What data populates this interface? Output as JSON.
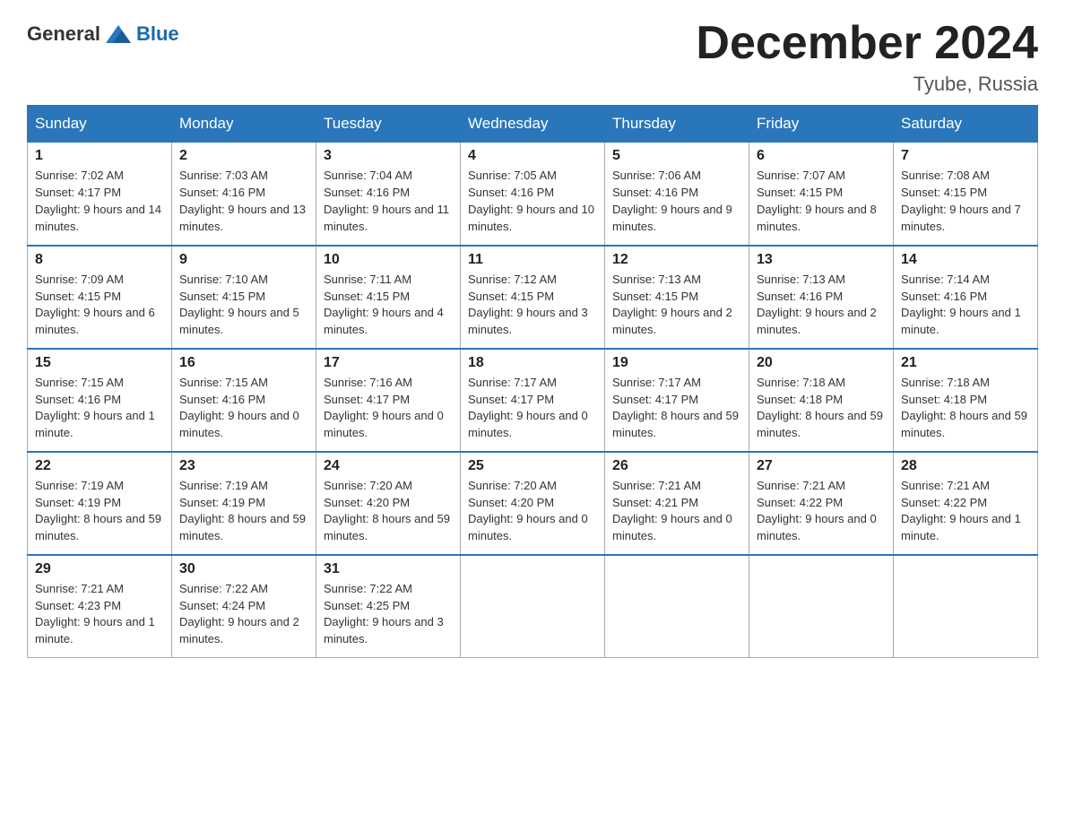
{
  "header": {
    "logo_general": "General",
    "logo_blue": "Blue",
    "month_title": "December 2024",
    "location": "Tyube, Russia"
  },
  "days_of_week": [
    "Sunday",
    "Monday",
    "Tuesday",
    "Wednesday",
    "Thursday",
    "Friday",
    "Saturday"
  ],
  "weeks": [
    [
      {
        "day": "1",
        "sunrise": "7:02 AM",
        "sunset": "4:17 PM",
        "daylight": "9 hours and 14 minutes."
      },
      {
        "day": "2",
        "sunrise": "7:03 AM",
        "sunset": "4:16 PM",
        "daylight": "9 hours and 13 minutes."
      },
      {
        "day": "3",
        "sunrise": "7:04 AM",
        "sunset": "4:16 PM",
        "daylight": "9 hours and 11 minutes."
      },
      {
        "day": "4",
        "sunrise": "7:05 AM",
        "sunset": "4:16 PM",
        "daylight": "9 hours and 10 minutes."
      },
      {
        "day": "5",
        "sunrise": "7:06 AM",
        "sunset": "4:16 PM",
        "daylight": "9 hours and 9 minutes."
      },
      {
        "day": "6",
        "sunrise": "7:07 AM",
        "sunset": "4:15 PM",
        "daylight": "9 hours and 8 minutes."
      },
      {
        "day": "7",
        "sunrise": "7:08 AM",
        "sunset": "4:15 PM",
        "daylight": "9 hours and 7 minutes."
      }
    ],
    [
      {
        "day": "8",
        "sunrise": "7:09 AM",
        "sunset": "4:15 PM",
        "daylight": "9 hours and 6 minutes."
      },
      {
        "day": "9",
        "sunrise": "7:10 AM",
        "sunset": "4:15 PM",
        "daylight": "9 hours and 5 minutes."
      },
      {
        "day": "10",
        "sunrise": "7:11 AM",
        "sunset": "4:15 PM",
        "daylight": "9 hours and 4 minutes."
      },
      {
        "day": "11",
        "sunrise": "7:12 AM",
        "sunset": "4:15 PM",
        "daylight": "9 hours and 3 minutes."
      },
      {
        "day": "12",
        "sunrise": "7:13 AM",
        "sunset": "4:15 PM",
        "daylight": "9 hours and 2 minutes."
      },
      {
        "day": "13",
        "sunrise": "7:13 AM",
        "sunset": "4:16 PM",
        "daylight": "9 hours and 2 minutes."
      },
      {
        "day": "14",
        "sunrise": "7:14 AM",
        "sunset": "4:16 PM",
        "daylight": "9 hours and 1 minute."
      }
    ],
    [
      {
        "day": "15",
        "sunrise": "7:15 AM",
        "sunset": "4:16 PM",
        "daylight": "9 hours and 1 minute."
      },
      {
        "day": "16",
        "sunrise": "7:15 AM",
        "sunset": "4:16 PM",
        "daylight": "9 hours and 0 minutes."
      },
      {
        "day": "17",
        "sunrise": "7:16 AM",
        "sunset": "4:17 PM",
        "daylight": "9 hours and 0 minutes."
      },
      {
        "day": "18",
        "sunrise": "7:17 AM",
        "sunset": "4:17 PM",
        "daylight": "9 hours and 0 minutes."
      },
      {
        "day": "19",
        "sunrise": "7:17 AM",
        "sunset": "4:17 PM",
        "daylight": "8 hours and 59 minutes."
      },
      {
        "day": "20",
        "sunrise": "7:18 AM",
        "sunset": "4:18 PM",
        "daylight": "8 hours and 59 minutes."
      },
      {
        "day": "21",
        "sunrise": "7:18 AM",
        "sunset": "4:18 PM",
        "daylight": "8 hours and 59 minutes."
      }
    ],
    [
      {
        "day": "22",
        "sunrise": "7:19 AM",
        "sunset": "4:19 PM",
        "daylight": "8 hours and 59 minutes."
      },
      {
        "day": "23",
        "sunrise": "7:19 AM",
        "sunset": "4:19 PM",
        "daylight": "8 hours and 59 minutes."
      },
      {
        "day": "24",
        "sunrise": "7:20 AM",
        "sunset": "4:20 PM",
        "daylight": "8 hours and 59 minutes."
      },
      {
        "day": "25",
        "sunrise": "7:20 AM",
        "sunset": "4:20 PM",
        "daylight": "9 hours and 0 minutes."
      },
      {
        "day": "26",
        "sunrise": "7:21 AM",
        "sunset": "4:21 PM",
        "daylight": "9 hours and 0 minutes."
      },
      {
        "day": "27",
        "sunrise": "7:21 AM",
        "sunset": "4:22 PM",
        "daylight": "9 hours and 0 minutes."
      },
      {
        "day": "28",
        "sunrise": "7:21 AM",
        "sunset": "4:22 PM",
        "daylight": "9 hours and 1 minute."
      }
    ],
    [
      {
        "day": "29",
        "sunrise": "7:21 AM",
        "sunset": "4:23 PM",
        "daylight": "9 hours and 1 minute."
      },
      {
        "day": "30",
        "sunrise": "7:22 AM",
        "sunset": "4:24 PM",
        "daylight": "9 hours and 2 minutes."
      },
      {
        "day": "31",
        "sunrise": "7:22 AM",
        "sunset": "4:25 PM",
        "daylight": "9 hours and 3 minutes."
      },
      null,
      null,
      null,
      null
    ]
  ],
  "labels": {
    "sunrise": "Sunrise:",
    "sunset": "Sunset:",
    "daylight": "Daylight:"
  }
}
